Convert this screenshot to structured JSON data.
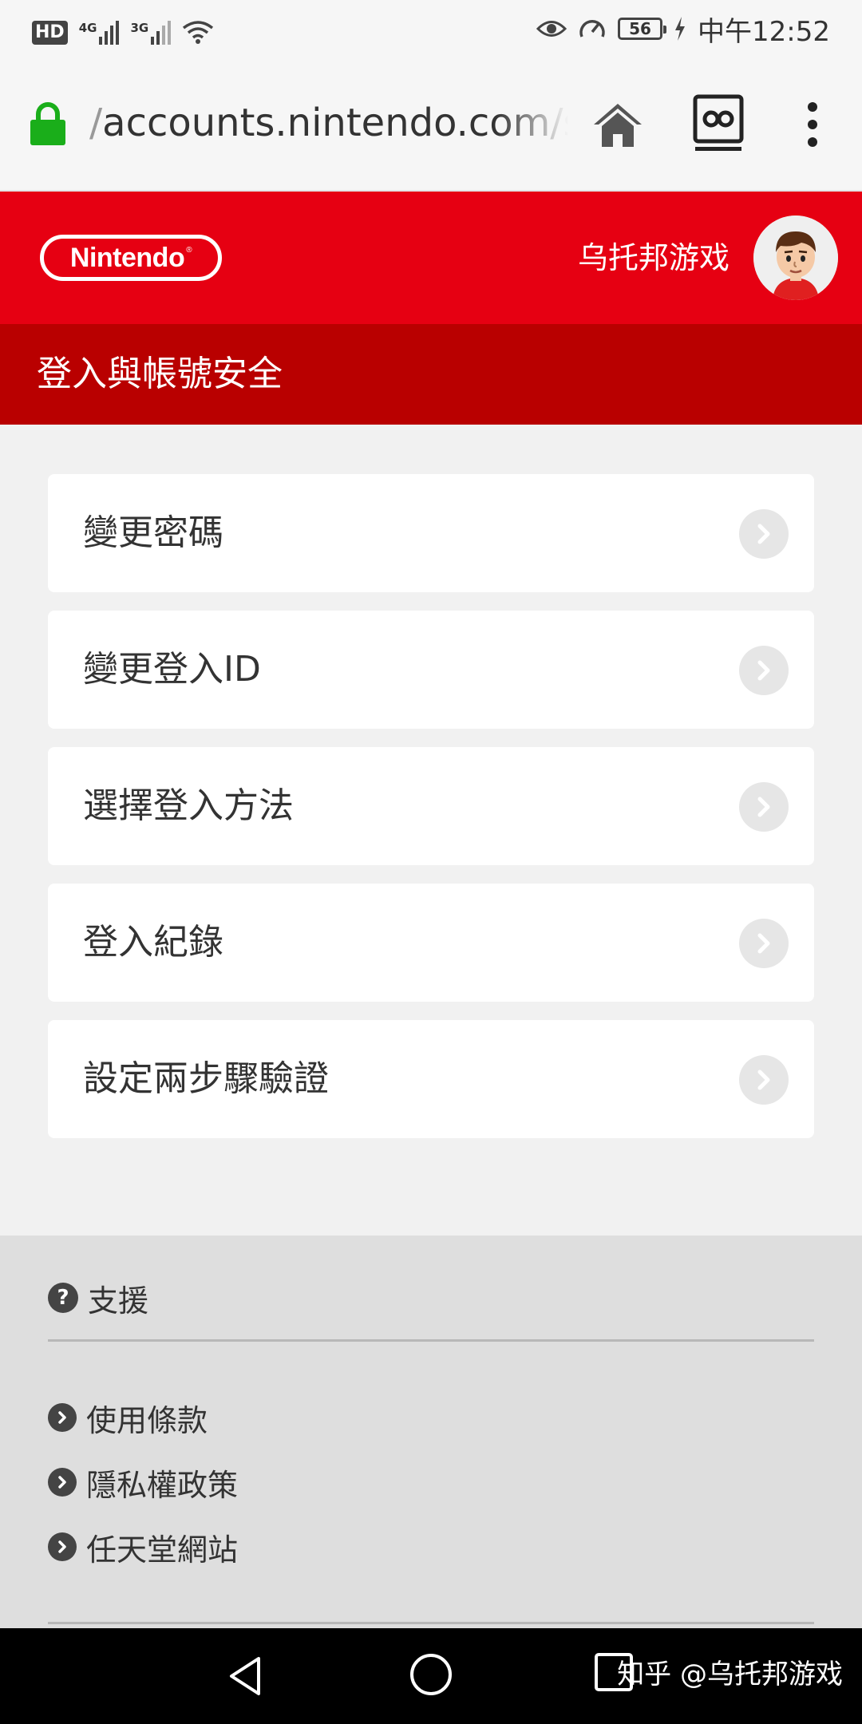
{
  "status_bar": {
    "hd_badge": "HD",
    "network_1": "4G",
    "network_2": "3G",
    "battery_level": "56",
    "time": "中午12:52"
  },
  "browser": {
    "url_prefix": "/",
    "url": "accounts.nintendo.com/se"
  },
  "header": {
    "logo_text": "Nintendo",
    "username": "乌托邦游戏",
    "section_title": "登入與帳號安全"
  },
  "menu": {
    "items": [
      {
        "label": "變更密碼"
      },
      {
        "label": "變更登入ID"
      },
      {
        "label": "選擇登入方法"
      },
      {
        "label": "登入紀錄"
      },
      {
        "label": "設定兩步驟驗證"
      }
    ]
  },
  "footer": {
    "support_label": "支援",
    "links": [
      {
        "label": "使用條款"
      },
      {
        "label": "隱私權政策"
      },
      {
        "label": "任天堂網站"
      }
    ]
  },
  "watermark": "知乎 @乌托邦游戏",
  "colors": {
    "nintendo_red": "#e60012",
    "section_red": "#b90000",
    "lock_green": "#1aae1a"
  },
  "icons": {
    "lock": "lock-icon",
    "home": "home-icon",
    "tabs": "tabs-icon",
    "menu": "more-vert-icon",
    "chevron": "chevron-right-icon",
    "support": "question-circle-icon",
    "link_arrow": "arrow-circle-icon"
  }
}
